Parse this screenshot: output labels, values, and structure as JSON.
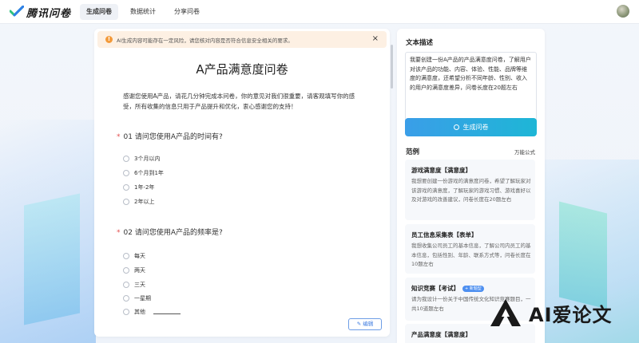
{
  "app": {
    "name": "腾讯问卷"
  },
  "nav": {
    "tabs": [
      {
        "label": "生成问卷",
        "active": true
      },
      {
        "label": "数据统计",
        "active": false
      },
      {
        "label": "分享问卷",
        "active": false
      }
    ]
  },
  "notice": {
    "text": "AI生成内容可能存在一定风险，请您核对内容是否符合信息安全相关的要求。",
    "close": "×"
  },
  "form": {
    "title": "A产品满意度问卷",
    "intro": "感谢您使用A产品，请花几分钟完成本问卷，你的意见对我们很重要，请客观填写你的感受，所有收集的信息只用于产品提升和优化，衷心感谢您的支持！",
    "questions": [
      {
        "number": "01",
        "text": "请问您使用A产品的时间有?",
        "required_mark": "*",
        "options": [
          "3个月以内",
          "6个月到1年",
          "1年-2年",
          "2年以上"
        ]
      },
      {
        "number": "02",
        "text": "请问您使用A产品的频率是?",
        "required_mark": "*",
        "options": [
          "每天",
          "两天",
          "三天",
          "一星期",
          "其他"
        ]
      }
    ],
    "edit_label": "编辑"
  },
  "sidebar": {
    "desc_title": "文本描述",
    "desc_text": "我要创建一份A产品的产品满意度问卷，了解用户对该产品的功能、内容、体验、性能、品牌等维度的满意度，还希望分析不同年龄、性别、收入的用户的满意度差异，问卷长度在20题左右",
    "generate_label": "生成问卷",
    "examples_title": "范例",
    "examples_link": "万能公式",
    "examples": [
      {
        "title": "游戏满意度【满意度】",
        "body": "我想要创建一份游戏的满意度问卷，希望了解玩家对该游戏的满意度，了解玩家的游戏习惯、游戏喜好以及对游戏的改善建议，问卷长度在20题左右"
      },
      {
        "title": "员工信息采集表【表单】",
        "body": "我想收集公司员工的基本信息，了解公司内员工的基本信息，包括性别、年龄、联系方式等，问卷长度在10题左右"
      },
      {
        "title": "知识竞赛【考试】",
        "badge": "+ 新题型",
        "body": "请为我设计一份关于中国传统文化知识竞赛题目，一共10道题左右"
      },
      {
        "title": "产品满意度【满意度】",
        "body": ""
      }
    ]
  },
  "watermark": {
    "text": "AI爱论文"
  },
  "colors": {
    "accent": "#3a9ee8",
    "accent2": "#1eb6d6",
    "warning_bg": "#fdf0e3",
    "warning_icon": "#f39a3a",
    "required": "#e34d4d",
    "logo_green": "#2ec27e",
    "logo_blue": "#2f7fe8"
  }
}
